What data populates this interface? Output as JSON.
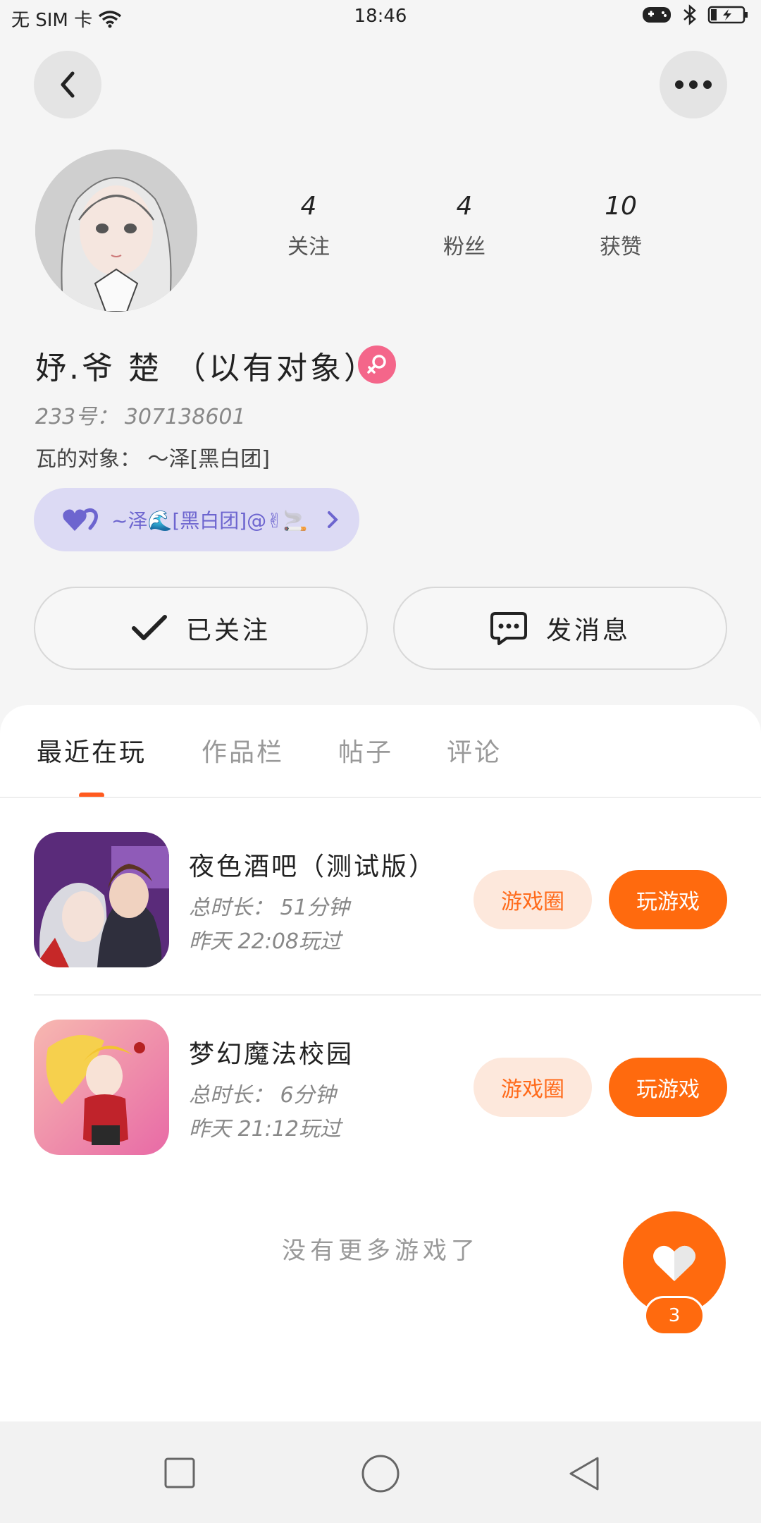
{
  "status_bar": {
    "carrier": "无 SIM 卡",
    "time": "18:46",
    "icons": [
      "wifi-icon",
      "game-icon",
      "bluetooth-icon",
      "battery-charging-icon"
    ]
  },
  "header": {
    "back_icon": "chevron-left-icon",
    "more_icon": "more-dots-icon"
  },
  "profile": {
    "stats": [
      {
        "value": "4",
        "label": "关注"
      },
      {
        "value": "4",
        "label": "粉丝"
      },
      {
        "value": "10",
        "label": "获赞"
      }
    ],
    "nickname": "妤.爷 楚 （以有对象）",
    "gender_icon": "female-icon",
    "id_line": "233号： 307138601",
    "partner_line": "瓦的对象： ～泽[黑白团]",
    "cp_chip": {
      "icon": "heart-pair-icon",
      "label": "~泽🌊[黑白团]@✌🚬",
      "chevron": "chevron-right-icon"
    }
  },
  "actions": {
    "follow_label": "已关注",
    "message_label": "发消息"
  },
  "tabs": [
    {
      "label": "最近在玩",
      "active": true
    },
    {
      "label": "作品栏",
      "active": false
    },
    {
      "label": "帖子",
      "active": false
    },
    {
      "label": "评论",
      "active": false
    }
  ],
  "games": [
    {
      "title": "夜色酒吧（测试版）",
      "duration": "总时长： 51分钟",
      "last_played": "昨天 22:08玩过",
      "circle_label": "游戏圈",
      "play_label": "玩游戏"
    },
    {
      "title": "梦幻魔法校园",
      "duration": "总时长： 6分钟",
      "last_played": "昨天 21:12玩过",
      "circle_label": "游戏圈",
      "play_label": "玩游戏"
    }
  ],
  "footer_note": "没有更多游戏了",
  "like_fab": {
    "count": "3"
  },
  "colors": {
    "accent": "#ff6a0e",
    "accent_light": "#fde8dc",
    "chip_bg": "#dcdaf4",
    "gender_pink": "#f4668a"
  }
}
